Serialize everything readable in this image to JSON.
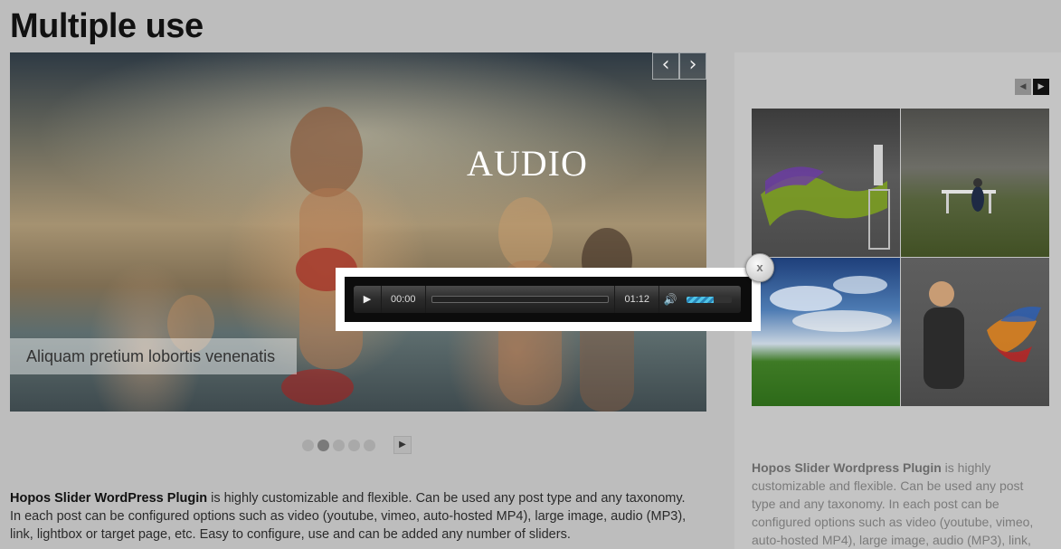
{
  "page": {
    "title": "Multiple use"
  },
  "slider": {
    "prev_icon": "chevron-left-icon",
    "next_icon": "chevron-right-icon",
    "prev_glyph": "‹",
    "next_glyph": "›",
    "heading": "AUDIO",
    "caption": "Aliquam pretium lobortis venenatis",
    "pager": {
      "count": 5,
      "active_index": 1,
      "next_glyph": "▶"
    }
  },
  "main_text": {
    "bold": "Hopos Slider WordPress Plugin",
    "rest": " is highly customizable and flexible. Can be used any post type and any taxonomy. In each post can be configured options such as video (youtube, vimeo, auto-hosted MP4), large image, audio (MP3), link, lightbox or target page, etc. Easy to configure, use and can be added any number of sliders."
  },
  "side_panel": {
    "prev_glyph": "◀",
    "next_glyph": "▶",
    "text_bold": "Hopos Slider Wordpress Plugin",
    "text_rest": " is highly customizable and flexible. Can be used any post type and any taxonomy. In each post can be configured options such as video (youtube, vimeo, auto-hosted MP4), large image, audio (MP3), link,"
  },
  "audio_player": {
    "play_glyph": "▶",
    "current_time": "00:00",
    "duration": "01:12",
    "progress": 0,
    "volume_glyph": "🔊",
    "volume_level": 0.6,
    "close_label": "x"
  },
  "colors": {
    "volume_fill": "#4fc4e8",
    "background": "#bdbdbd"
  }
}
